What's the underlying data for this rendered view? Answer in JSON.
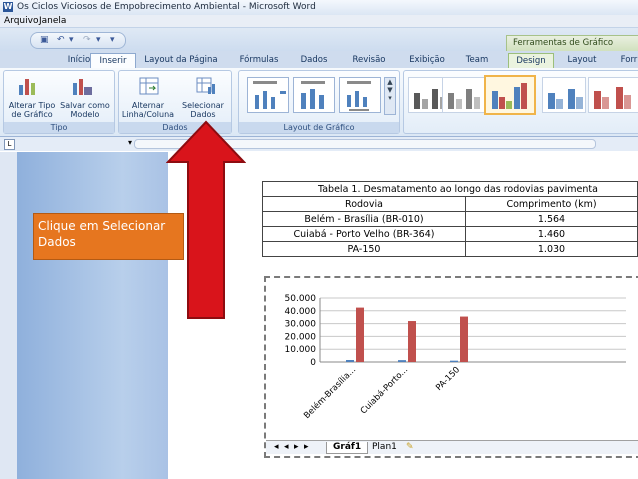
{
  "window": {
    "title": "Os Ciclos Viciosos de Empobrecimento Ambiental - Microsoft Word",
    "app_icon": "word-icon"
  },
  "menu": {
    "items": [
      "Arquivo",
      "Janela"
    ]
  },
  "contextual": {
    "label": "Ferramentas de Gráfico"
  },
  "tabs": [
    "Início",
    "Inserir",
    "Layout da Página",
    "Fórmulas",
    "Dados",
    "Revisão",
    "Exibição",
    "Team",
    "Design",
    "Layout",
    "Forr"
  ],
  "ribbon": {
    "tipo": {
      "label": "Tipo",
      "buttons": [
        {
          "line1": "Alterar Tipo",
          "line2": "de Gráfico"
        },
        {
          "line1": "Salvar como",
          "line2": "Modelo"
        }
      ]
    },
    "dados": {
      "label": "Dados",
      "buttons": [
        {
          "line1": "Alternar",
          "line2": "Linha/Coluna"
        },
        {
          "line1": "Selecionar",
          "line2": "Dados"
        }
      ]
    },
    "layout": {
      "label": "Layout de Gráfico"
    }
  },
  "callout": {
    "text": "Clique em Selecionar Dados"
  },
  "colors": {
    "arrow": "#d9141b",
    "callout": "#e6761f",
    "bar_red": "#c0504d",
    "bar_blue": "#4f81bd"
  },
  "table": {
    "title": "Tabela 1. Desmatamento ao longo das rodovias pavimenta",
    "headers": [
      "Rodovia",
      "Comprimento (km)"
    ],
    "rows": [
      [
        "Belém - Brasília (BR-010)",
        "1.564"
      ],
      [
        "Cuiabá - Porto Velho (BR-364)",
        "1.460"
      ],
      [
        "PA-150",
        "1.030"
      ]
    ]
  },
  "sheet_tabs": [
    "Gráf1",
    "Plan1"
  ],
  "chart_data": {
    "type": "bar",
    "categories": [
      "Belém-Brasília...",
      "Cuiabá-Porto...",
      "PA-150"
    ],
    "series": [
      {
        "values": [
          1564,
          1460,
          1030
        ],
        "color": "#4f81bd"
      },
      {
        "values": [
          42500,
          32000,
          35500
        ],
        "color": "#c0504d"
      }
    ],
    "ylim": [
      0,
      50000
    ],
    "yticks": [
      "0",
      "10.000",
      "20.000",
      "30.000",
      "40.000",
      "50.000"
    ],
    "grid": true
  }
}
